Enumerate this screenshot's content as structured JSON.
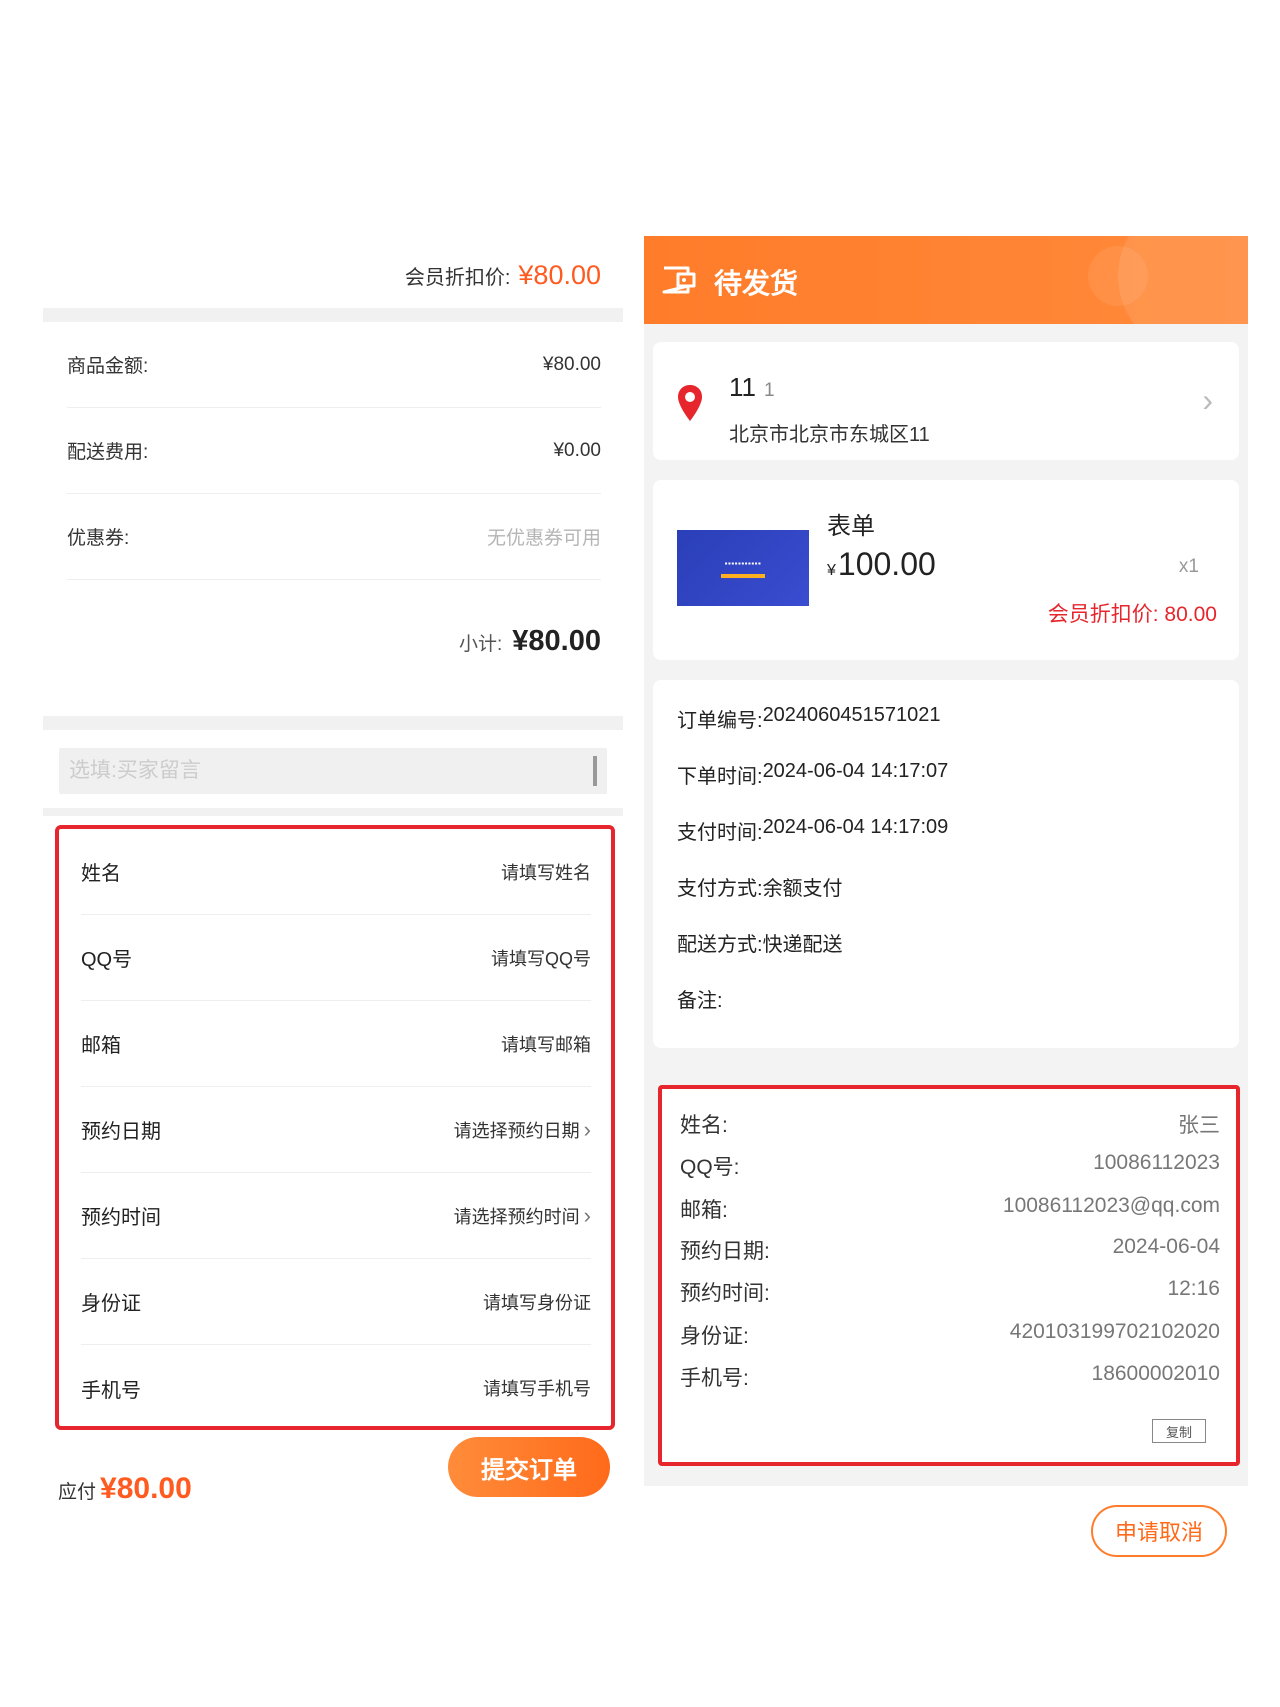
{
  "left": {
    "member_price_label": "会员折扣价:",
    "member_price_value": "¥80.00",
    "summary": [
      {
        "label": "商品金额:",
        "value": "¥80.00"
      },
      {
        "label": "配送费用:",
        "value": "¥0.00"
      },
      {
        "label": "优惠券:",
        "value": "无优惠券可用"
      }
    ],
    "subtotal_label": "小计:",
    "subtotal_value": "¥80.00",
    "message_placeholder": "选填:买家留言",
    "form": [
      {
        "label": "姓名",
        "placeholder": "请填写姓名"
      },
      {
        "label": "QQ号",
        "placeholder": "请填写QQ号"
      },
      {
        "label": "邮箱",
        "placeholder": "请填写邮箱"
      },
      {
        "label": "预约日期",
        "placeholder": "请选择预约日期"
      },
      {
        "label": "预约时间",
        "placeholder": "请选择预约时间"
      },
      {
        "label": "身份证",
        "placeholder": "请填写身份证"
      },
      {
        "label": "手机号",
        "placeholder": "请填写手机号"
      }
    ],
    "pay_label": "应付",
    "pay_value": "¥80.00",
    "submit_label": "提交订单"
  },
  "right": {
    "status": "待发货",
    "address": {
      "name": "11",
      "phone": "1",
      "line": "北京市北京市东城区11"
    },
    "product": {
      "name": "表单",
      "currency": "¥",
      "price": "100.00",
      "qty": "x1",
      "member_price": "会员折扣价: 80.00"
    },
    "order": [
      {
        "label": "订单编号:",
        "value": "2024060451571021"
      },
      {
        "label": "下单时间:",
        "value": "2024-06-04 14:17:07"
      },
      {
        "label": "支付时间:",
        "value": "2024-06-04 14:17:09"
      },
      {
        "label": "支付方式:",
        "value": "余额支付"
      },
      {
        "label": "配送方式:",
        "value": "快递配送"
      },
      {
        "label": "备注:",
        "value": ""
      }
    ],
    "info": [
      {
        "label": "姓名:",
        "value": "张三"
      },
      {
        "label": "QQ号:",
        "value": "10086112023"
      },
      {
        "label": "邮箱:",
        "value": "10086112023@qq.com"
      },
      {
        "label": "预约日期:",
        "value": "2024-06-04"
      },
      {
        "label": "预约时间:",
        "value": "12:16"
      },
      {
        "label": "身份证:",
        "value": "420103199702102020"
      },
      {
        "label": "手机号:",
        "value": "18600002010"
      }
    ],
    "copy_label": "复制",
    "cancel_label": "申请取消"
  },
  "colors": {
    "accent": "#ff7c2a",
    "price": "#ff5a1f",
    "highlight_border": "#e6262c"
  }
}
